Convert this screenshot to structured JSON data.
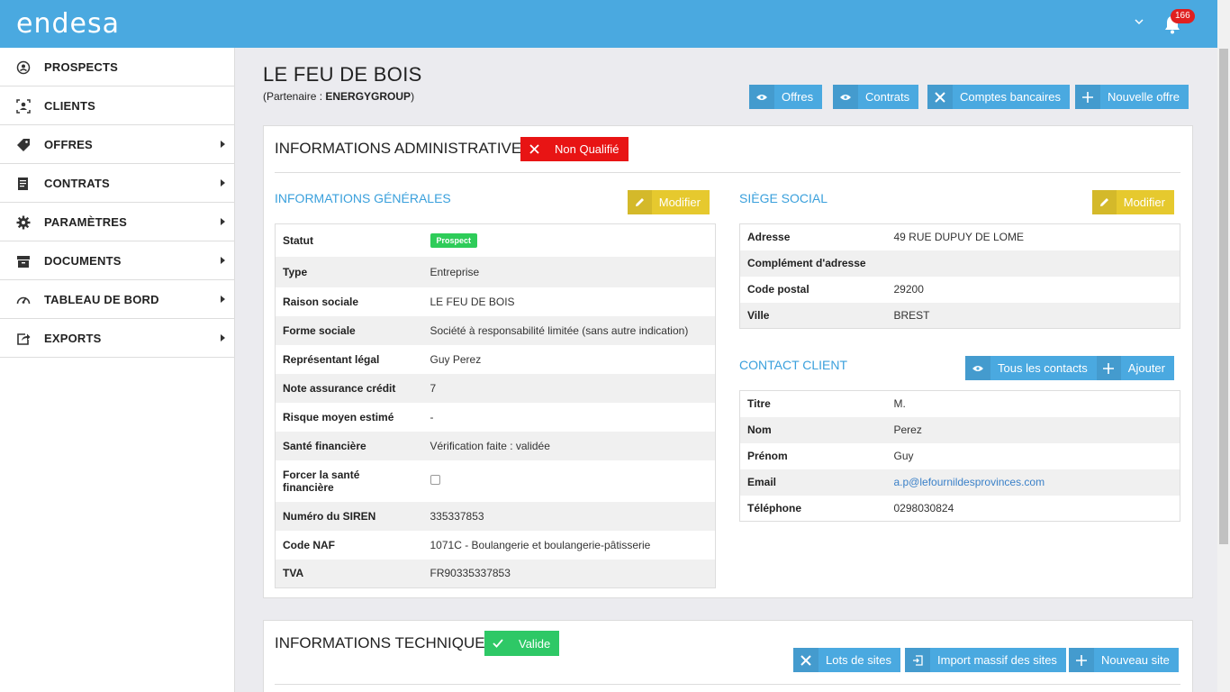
{
  "app": {
    "logo": "endesa",
    "notifications_count": "166"
  },
  "sidebar": {
    "items": [
      {
        "label": "PROSPECTS",
        "icon": "user-circle-icon",
        "has_caret": false
      },
      {
        "label": "CLIENTS",
        "icon": "user-frame-icon",
        "has_caret": false
      },
      {
        "label": "OFFRES",
        "icon": "tag-icon",
        "has_caret": true
      },
      {
        "label": "CONTRATS",
        "icon": "document-icon",
        "has_caret": true
      },
      {
        "label": "PARAMÈTRES",
        "icon": "gear-icon",
        "has_caret": true
      },
      {
        "label": "DOCUMENTS",
        "icon": "archive-icon",
        "has_caret": true
      },
      {
        "label": "TABLEAU DE BORD",
        "icon": "dashboard-icon",
        "has_caret": true
      },
      {
        "label": "EXPORTS",
        "icon": "export-icon",
        "has_caret": true
      }
    ]
  },
  "header": {
    "title": "LE FEU DE BOIS",
    "partner_prefix": "(Partenaire : ",
    "partner_name": "ENERGYGROUP",
    "partner_suffix": ")",
    "buttons": {
      "offres": "Offres",
      "contrats": "Contrats",
      "comptes": "Comptes bancaires",
      "nouvelle_offre": "Nouvelle offre"
    }
  },
  "admin": {
    "title": "INFORMATIONS ADMINISTRATIVES",
    "status_label": "Non Qualifié",
    "status_color": "#e81414",
    "general": {
      "title": "INFORMATIONS GÉNÉRALES",
      "modify_label": "Modifier",
      "statut_label": "Statut",
      "statut_value": "Prospect",
      "rows": [
        {
          "key": "Type",
          "value": "Entreprise"
        },
        {
          "key": "Raison sociale",
          "value": "LE FEU DE BOIS"
        },
        {
          "key": "Forme sociale",
          "value": "Société à responsabilité limitée (sans autre indication)"
        },
        {
          "key": "Représentant légal",
          "value": "Guy Perez"
        },
        {
          "key": "Note assurance crédit",
          "value": "7"
        },
        {
          "key": "Risque moyen estimé",
          "value": "-"
        },
        {
          "key": "Santé financière",
          "value": "Vérification faite : validée"
        }
      ],
      "forcer_label_1": "Forcer la santé",
      "forcer_label_2": "financière",
      "rows2": [
        {
          "key": "Numéro du SIREN",
          "value": "335337853"
        },
        {
          "key": "Code NAF",
          "value": "1071C - Boulangerie et boulangerie-pâtisserie"
        },
        {
          "key": "TVA",
          "value": "FR90335337853"
        }
      ]
    },
    "siege": {
      "title": "SIÈGE SOCIAL",
      "modify_label": "Modifier",
      "rows": [
        {
          "key": "Adresse",
          "value": "49 RUE DUPUY DE LOME"
        },
        {
          "key": "Complément d'adresse",
          "value": ""
        },
        {
          "key": "Code postal",
          "value": "29200"
        },
        {
          "key": "Ville",
          "value": "BREST"
        }
      ]
    },
    "contact": {
      "title": "CONTACT CLIENT",
      "all_contacts_label": "Tous les contacts",
      "add_label": "Ajouter",
      "rows": [
        {
          "key": "Titre",
          "value": "M."
        },
        {
          "key": "Nom",
          "value": "Perez"
        },
        {
          "key": "Prénom",
          "value": "Guy"
        },
        {
          "key": "Email",
          "value": "a.p@lefournildesprovinces.com"
        },
        {
          "key": "Téléphone",
          "value": "0298030824"
        }
      ]
    }
  },
  "technique": {
    "title": "INFORMATIONS TECHNIQUES",
    "status_label": "Valide",
    "status_color": "#2ec866",
    "buttons": {
      "lots": "Lots de sites",
      "import": "Import massif des sites",
      "nouveau": "Nouveau site"
    }
  },
  "colors": {
    "accent": "#4aa9e0",
    "modify": "#e6c92e",
    "section_title": "#3aa0dc"
  }
}
